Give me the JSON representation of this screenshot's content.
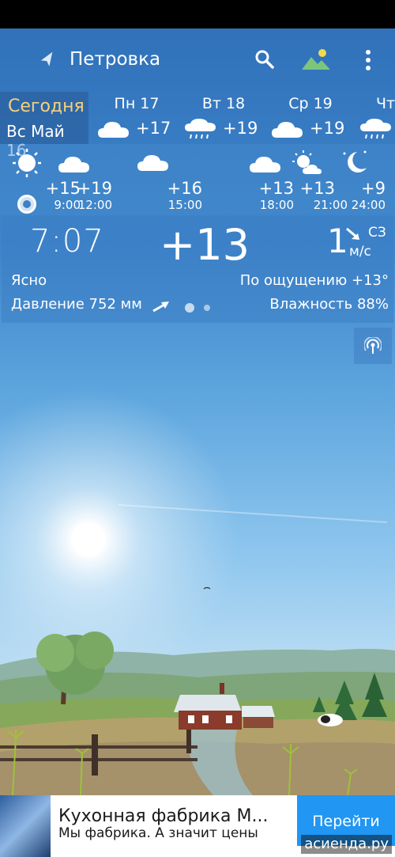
{
  "header": {
    "location": "Петровка",
    "icons": [
      "location-arrow-icon",
      "search-icon",
      "landscape-icon",
      "more-vert-icon"
    ]
  },
  "days": {
    "today_label": "Сегодня",
    "today_date": "Вс Май 16",
    "items": [
      {
        "name": "Пн 17",
        "temp": "+17",
        "icon": "cloud-icon"
      },
      {
        "name": "Вт 18",
        "temp": "+19",
        "icon": "rain-icon"
      },
      {
        "name": "Ср 19",
        "temp": "+19",
        "icon": "cloud-icon"
      },
      {
        "name": "Чт",
        "temp": "",
        "icon": "rain-icon"
      }
    ]
  },
  "hours": [
    {
      "time": "9:00",
      "temp": "+15",
      "icon": "sun-icon"
    },
    {
      "time": "12:00",
      "temp": "+19",
      "icon": "cloud-icon"
    },
    {
      "time": "15:00",
      "temp": "+16",
      "icon": "partly-cloudy-icon"
    },
    {
      "time": "18:00",
      "temp": "+13",
      "icon": "cloud-icon"
    },
    {
      "time": "21:00",
      "temp": "+13",
      "icon": "sun-cloud-icon"
    },
    {
      "time": "24:00",
      "temp": "+9",
      "icon": "moon-icon"
    }
  ],
  "current": {
    "time": "7:07",
    "temp": "+13",
    "wind_speed": "1",
    "wind_dir": "СЗ",
    "wind_unit": "м/с",
    "condition": "Ясно",
    "feels_like": "По ощущению +13°",
    "pressure": "Давление 752 мм",
    "humidity": "Влажность 88%"
  },
  "ad": {
    "title": "Кухонная фабрика М...",
    "subtitle": "Мы фабрика. А значит цены",
    "button": "Перейти",
    "domain": "асиенда.ру"
  },
  "colors": {
    "accent_today": "#f4d27a",
    "ad_button": "#2196f3"
  }
}
